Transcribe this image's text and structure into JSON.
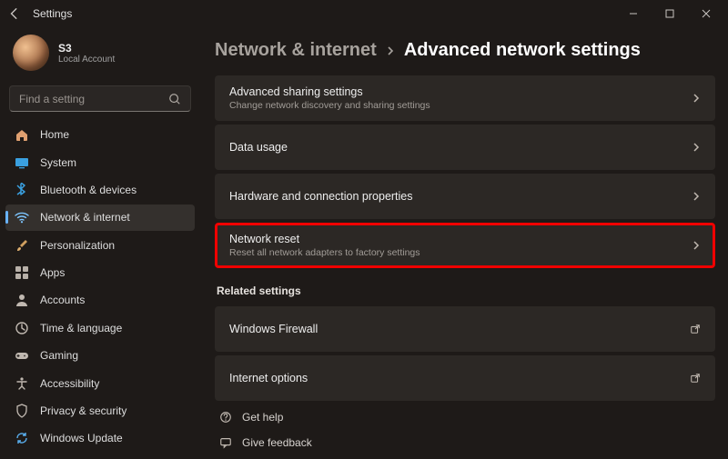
{
  "titlebar": {
    "app": "Settings"
  },
  "account": {
    "name": "S3",
    "sub": "Local Account"
  },
  "search": {
    "placeholder": "Find a setting"
  },
  "sidebar": {
    "items": [
      {
        "label": "Home"
      },
      {
        "label": "System"
      },
      {
        "label": "Bluetooth & devices"
      },
      {
        "label": "Network & internet"
      },
      {
        "label": "Personalization"
      },
      {
        "label": "Apps"
      },
      {
        "label": "Accounts"
      },
      {
        "label": "Time & language"
      },
      {
        "label": "Gaming"
      },
      {
        "label": "Accessibility"
      },
      {
        "label": "Privacy & security"
      },
      {
        "label": "Windows Update"
      }
    ]
  },
  "breadcrumb": {
    "parent": "Network & internet",
    "current": "Advanced network settings"
  },
  "cards": [
    {
      "title": "Advanced sharing settings",
      "sub": "Change network discovery and sharing settings"
    },
    {
      "title": "Data usage",
      "sub": ""
    },
    {
      "title": "Hardware and connection properties",
      "sub": ""
    },
    {
      "title": "Network reset",
      "sub": "Reset all network adapters to factory settings"
    }
  ],
  "related_heading": "Related settings",
  "related": [
    {
      "title": "Windows Firewall"
    },
    {
      "title": "Internet options"
    }
  ],
  "footer": {
    "help": "Get help",
    "feedback": "Give feedback"
  }
}
